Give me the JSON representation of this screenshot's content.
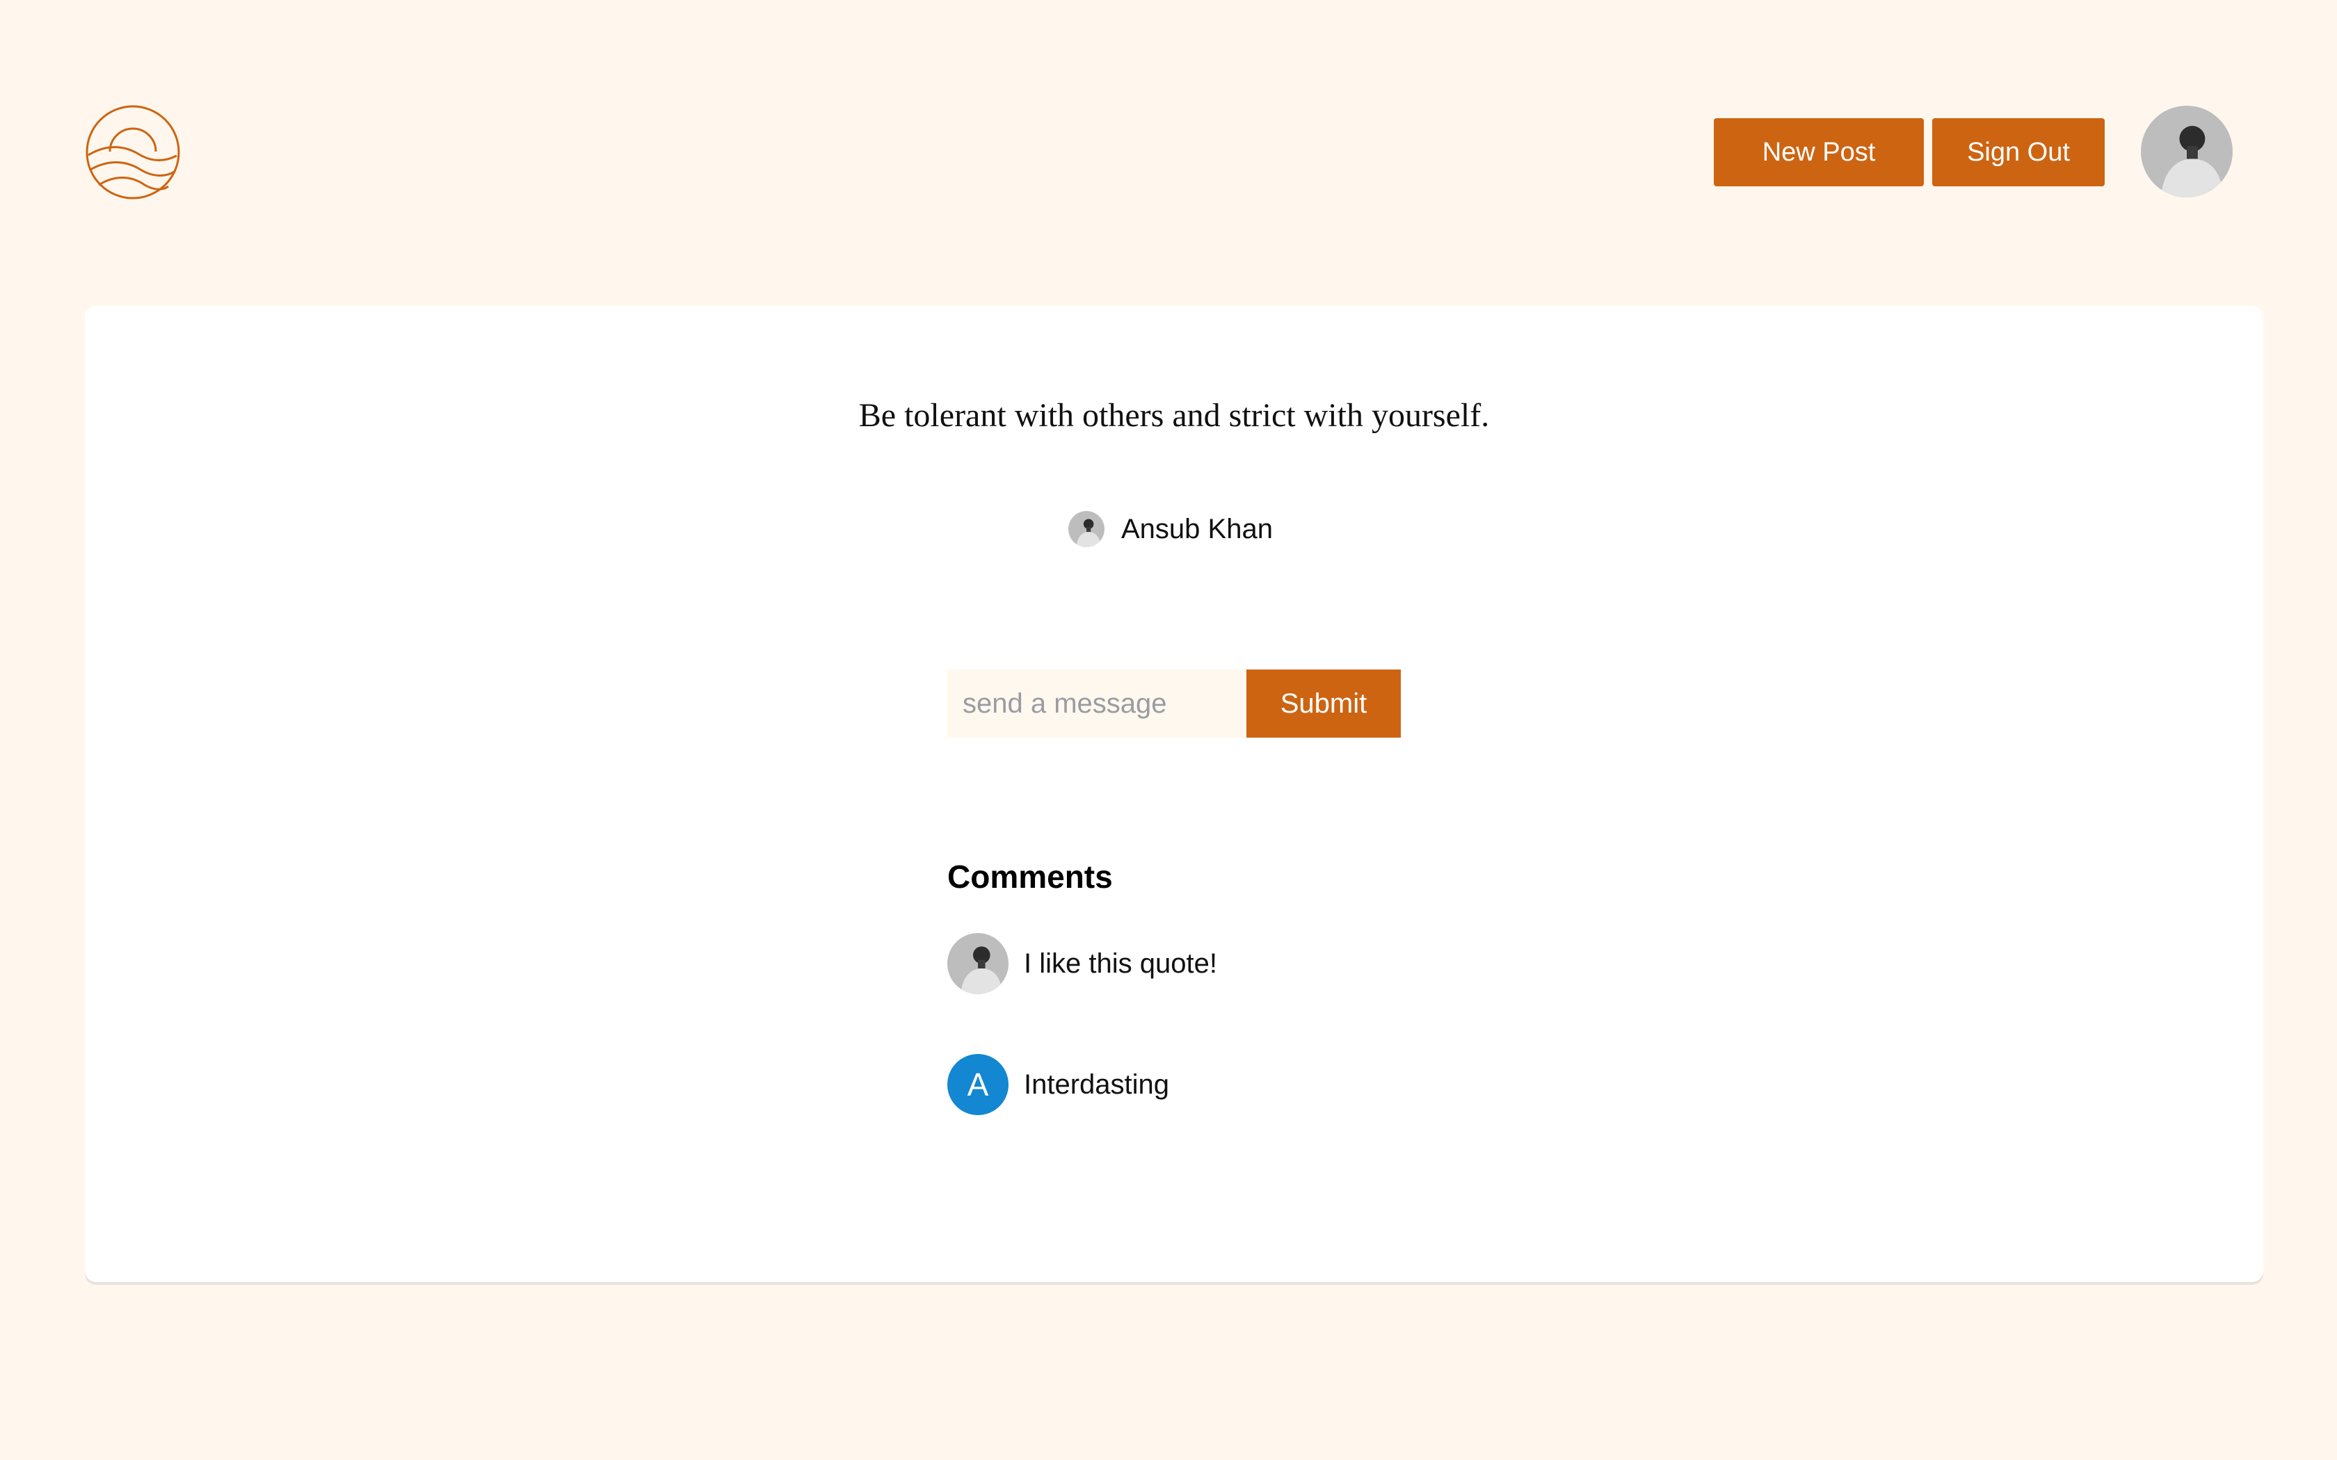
{
  "header": {
    "logo_icon": "sun-waves-logo-icon",
    "new_post_label": "New Post",
    "sign_out_label": "Sign Out",
    "profile_avatar_icon": "profile-avatar"
  },
  "post": {
    "quote": "Be tolerant with others and strict with yourself.",
    "author": {
      "name": "Ansub Khan",
      "avatar_icon": "author-avatar"
    }
  },
  "message_form": {
    "placeholder": "send a message",
    "value": "",
    "submit_label": "Submit"
  },
  "comments": {
    "title": "Comments",
    "items": [
      {
        "avatar_type": "photo",
        "text": "I like this quote!"
      },
      {
        "avatar_type": "letter",
        "avatar_letter": "A",
        "avatar_color": "#1387d1",
        "text": "Interdasting"
      }
    ]
  },
  "colors": {
    "background": "#fff7ed",
    "accent": "#cd6412",
    "card": "#ffffff"
  }
}
